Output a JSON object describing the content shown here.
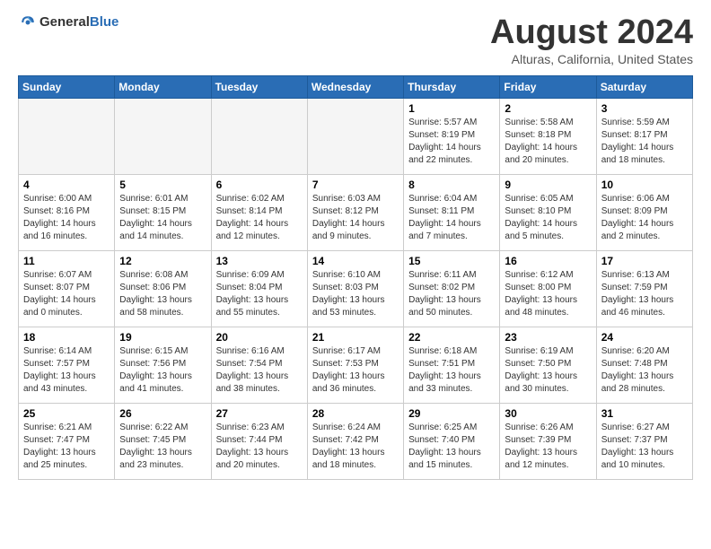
{
  "header": {
    "logo_general": "General",
    "logo_blue": "Blue",
    "month_title": "August 2024",
    "location": "Alturas, California, United States"
  },
  "weekdays": [
    "Sunday",
    "Monday",
    "Tuesday",
    "Wednesday",
    "Thursday",
    "Friday",
    "Saturday"
  ],
  "weeks": [
    [
      {
        "day": "",
        "info": ""
      },
      {
        "day": "",
        "info": ""
      },
      {
        "day": "",
        "info": ""
      },
      {
        "day": "",
        "info": ""
      },
      {
        "day": "1",
        "info": "Sunrise: 5:57 AM\nSunset: 8:19 PM\nDaylight: 14 hours\nand 22 minutes."
      },
      {
        "day": "2",
        "info": "Sunrise: 5:58 AM\nSunset: 8:18 PM\nDaylight: 14 hours\nand 20 minutes."
      },
      {
        "day": "3",
        "info": "Sunrise: 5:59 AM\nSunset: 8:17 PM\nDaylight: 14 hours\nand 18 minutes."
      }
    ],
    [
      {
        "day": "4",
        "info": "Sunrise: 6:00 AM\nSunset: 8:16 PM\nDaylight: 14 hours\nand 16 minutes."
      },
      {
        "day": "5",
        "info": "Sunrise: 6:01 AM\nSunset: 8:15 PM\nDaylight: 14 hours\nand 14 minutes."
      },
      {
        "day": "6",
        "info": "Sunrise: 6:02 AM\nSunset: 8:14 PM\nDaylight: 14 hours\nand 12 minutes."
      },
      {
        "day": "7",
        "info": "Sunrise: 6:03 AM\nSunset: 8:12 PM\nDaylight: 14 hours\nand 9 minutes."
      },
      {
        "day": "8",
        "info": "Sunrise: 6:04 AM\nSunset: 8:11 PM\nDaylight: 14 hours\nand 7 minutes."
      },
      {
        "day": "9",
        "info": "Sunrise: 6:05 AM\nSunset: 8:10 PM\nDaylight: 14 hours\nand 5 minutes."
      },
      {
        "day": "10",
        "info": "Sunrise: 6:06 AM\nSunset: 8:09 PM\nDaylight: 14 hours\nand 2 minutes."
      }
    ],
    [
      {
        "day": "11",
        "info": "Sunrise: 6:07 AM\nSunset: 8:07 PM\nDaylight: 14 hours\nand 0 minutes."
      },
      {
        "day": "12",
        "info": "Sunrise: 6:08 AM\nSunset: 8:06 PM\nDaylight: 13 hours\nand 58 minutes."
      },
      {
        "day": "13",
        "info": "Sunrise: 6:09 AM\nSunset: 8:04 PM\nDaylight: 13 hours\nand 55 minutes."
      },
      {
        "day": "14",
        "info": "Sunrise: 6:10 AM\nSunset: 8:03 PM\nDaylight: 13 hours\nand 53 minutes."
      },
      {
        "day": "15",
        "info": "Sunrise: 6:11 AM\nSunset: 8:02 PM\nDaylight: 13 hours\nand 50 minutes."
      },
      {
        "day": "16",
        "info": "Sunrise: 6:12 AM\nSunset: 8:00 PM\nDaylight: 13 hours\nand 48 minutes."
      },
      {
        "day": "17",
        "info": "Sunrise: 6:13 AM\nSunset: 7:59 PM\nDaylight: 13 hours\nand 46 minutes."
      }
    ],
    [
      {
        "day": "18",
        "info": "Sunrise: 6:14 AM\nSunset: 7:57 PM\nDaylight: 13 hours\nand 43 minutes."
      },
      {
        "day": "19",
        "info": "Sunrise: 6:15 AM\nSunset: 7:56 PM\nDaylight: 13 hours\nand 41 minutes."
      },
      {
        "day": "20",
        "info": "Sunrise: 6:16 AM\nSunset: 7:54 PM\nDaylight: 13 hours\nand 38 minutes."
      },
      {
        "day": "21",
        "info": "Sunrise: 6:17 AM\nSunset: 7:53 PM\nDaylight: 13 hours\nand 36 minutes."
      },
      {
        "day": "22",
        "info": "Sunrise: 6:18 AM\nSunset: 7:51 PM\nDaylight: 13 hours\nand 33 minutes."
      },
      {
        "day": "23",
        "info": "Sunrise: 6:19 AM\nSunset: 7:50 PM\nDaylight: 13 hours\nand 30 minutes."
      },
      {
        "day": "24",
        "info": "Sunrise: 6:20 AM\nSunset: 7:48 PM\nDaylight: 13 hours\nand 28 minutes."
      }
    ],
    [
      {
        "day": "25",
        "info": "Sunrise: 6:21 AM\nSunset: 7:47 PM\nDaylight: 13 hours\nand 25 minutes."
      },
      {
        "day": "26",
        "info": "Sunrise: 6:22 AM\nSunset: 7:45 PM\nDaylight: 13 hours\nand 23 minutes."
      },
      {
        "day": "27",
        "info": "Sunrise: 6:23 AM\nSunset: 7:44 PM\nDaylight: 13 hours\nand 20 minutes."
      },
      {
        "day": "28",
        "info": "Sunrise: 6:24 AM\nSunset: 7:42 PM\nDaylight: 13 hours\nand 18 minutes."
      },
      {
        "day": "29",
        "info": "Sunrise: 6:25 AM\nSunset: 7:40 PM\nDaylight: 13 hours\nand 15 minutes."
      },
      {
        "day": "30",
        "info": "Sunrise: 6:26 AM\nSunset: 7:39 PM\nDaylight: 13 hours\nand 12 minutes."
      },
      {
        "day": "31",
        "info": "Sunrise: 6:27 AM\nSunset: 7:37 PM\nDaylight: 13 hours\nand 10 minutes."
      }
    ]
  ]
}
